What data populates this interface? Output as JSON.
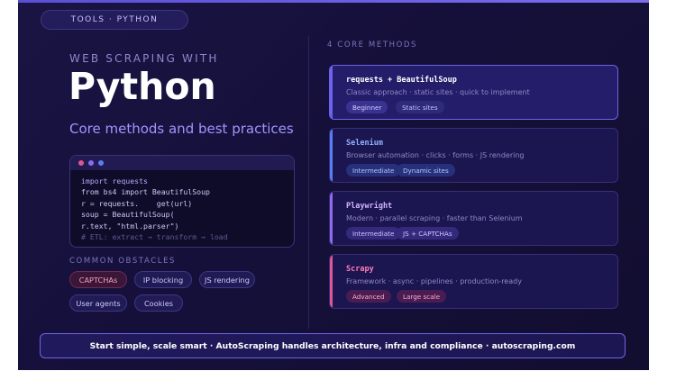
{
  "tag": "TOOLS · PYTHON",
  "hero": {
    "overline": "WEB SCRAPING WITH",
    "title": "Python",
    "subtitle": "Core methods and best practices"
  },
  "code": {
    "lines": [
      "import requests",
      "from bs4 import BeautifulSoup",
      "r = requests.    get(url)",
      "soup = BeautifulSoup(",
      "r.text, \"html.parser\")",
      "# ETL: extract → transform → load"
    ]
  },
  "obstacles": {
    "label": "COMMON OBSTACLES",
    "items": [
      "CAPTCHAs",
      "IP blocking",
      "JS rendering",
      "User agents",
      "Cookies"
    ]
  },
  "methods": {
    "label": "4 CORE METHODS",
    "items": [
      {
        "name": "requests + BeautifulSoup",
        "desc": "Classic approach · static sites · quick to implement",
        "chips": [
          "Beginner",
          "Static sites"
        ]
      },
      {
        "name": "Selenium",
        "desc": "Browser automation · clicks · forms · JS rendering",
        "chips": [
          "Intermediate",
          "Dynamic sites"
        ]
      },
      {
        "name": "Playwright",
        "desc": "Modern · parallel scraping · faster than Selenium",
        "chips": [
          "Intermediate",
          "JS + CAPTCHAs"
        ]
      },
      {
        "name": "Scrapy",
        "desc": "Framework · async · pipelines · production-ready",
        "chips": [
          "Advanced",
          "Large scale"
        ]
      }
    ]
  },
  "footer": "Start simple, scale smart · AutoScraping handles architecture, infra and compliance · autoscraping.com",
  "colors": {
    "accent": "#7b6cf0",
    "requests": "#6d62f0",
    "selenium": "#5a7cf5",
    "playwright": "#8d6bea",
    "scrapy": "#e05597"
  }
}
